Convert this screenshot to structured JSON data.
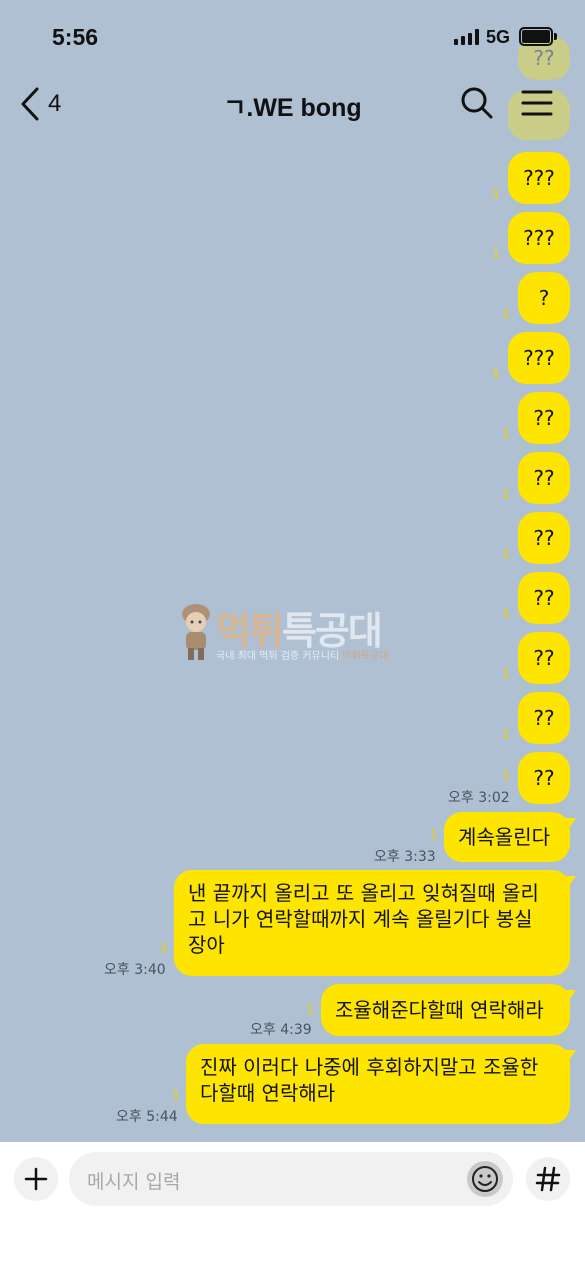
{
  "status_bar": {
    "time": "5:56",
    "network": "5G"
  },
  "header": {
    "back_count": "4",
    "title": "ㄱ.WE bong"
  },
  "messages": [
    {
      "text": "??",
      "unread": ""
    },
    {
      "text": "???",
      "unread": "1"
    },
    {
      "text": "???",
      "unread": "1"
    },
    {
      "text": "?",
      "unread": "1"
    },
    {
      "text": "???",
      "unread": "1"
    },
    {
      "text": "??",
      "unread": "1"
    },
    {
      "text": "??",
      "unread": "1"
    },
    {
      "text": "??",
      "unread": "1"
    },
    {
      "text": "??",
      "unread": "1"
    },
    {
      "text": "??",
      "unread": "1"
    },
    {
      "text": "??",
      "unread": "1"
    },
    {
      "text": "??",
      "unread": "1",
      "time": "오후 3:02"
    },
    {
      "text": "계속올린다",
      "unread": "1",
      "time": "오후 3:33"
    },
    {
      "line1": "낸 끝까지 올리고 또 올리고 잊혀질때 올리",
      "line2": "고 니가 연락할때까지 계속 올릴기다 봉실",
      "line3": "장아",
      "unread": "1",
      "time": "오후 3:40"
    },
    {
      "text": "조율해준다할때 연락해라",
      "unread": "1",
      "time": "오후 4:39"
    },
    {
      "line1": "진짜 이러다 나중에 후회하지말고 조율한",
      "line2": "다할때 연락해라",
      "unread": "1",
      "time": "오후 5:44"
    }
  ],
  "watermark": {
    "title_a": "먹튀",
    "title_b": "특공대",
    "subtitle": "국내 최대 먹튀 검증 커뮤니티",
    "subtitle_b": "먹튀특공대"
  },
  "input": {
    "placeholder": "메시지 입력"
  },
  "icons": {
    "back": "chevron-left-icon",
    "search": "search-icon",
    "menu": "hamburger-menu-icon",
    "plus": "plus-icon",
    "emoji": "smiley-icon",
    "hash": "hash-icon"
  },
  "colors": {
    "background": "#aec0d2",
    "bubble": "#fee500",
    "unread": "#f2d000"
  }
}
